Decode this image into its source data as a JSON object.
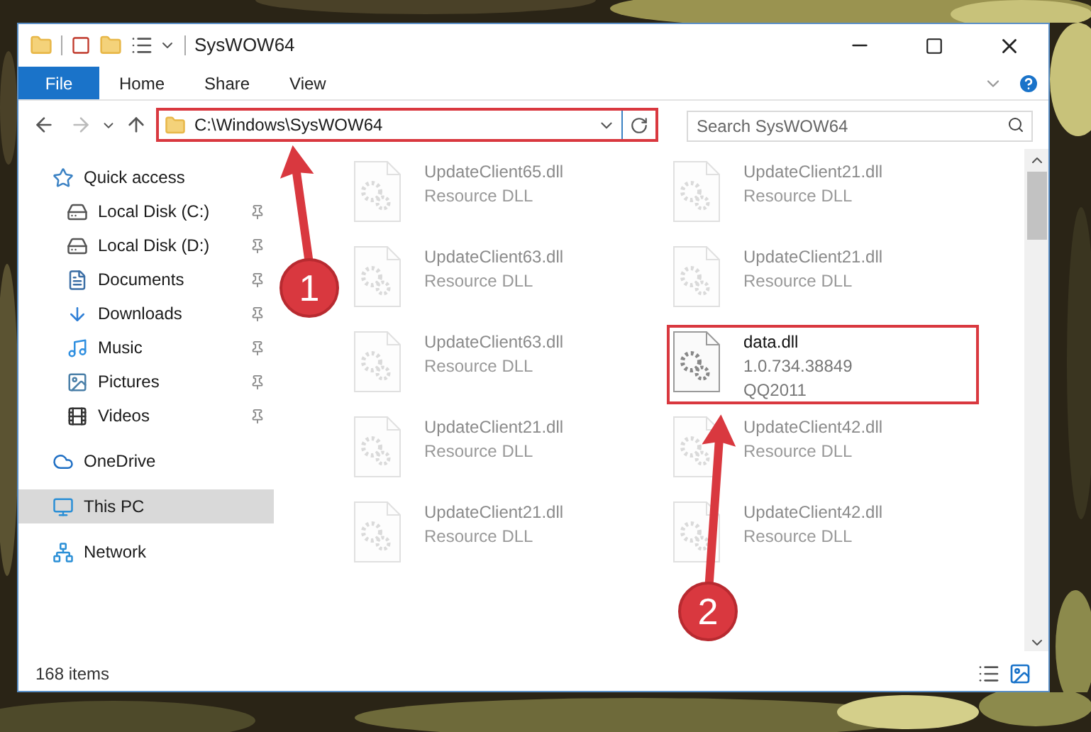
{
  "window": {
    "title": "SysWOW64"
  },
  "ribbon": {
    "file_tab": "File",
    "tabs": [
      "Home",
      "Share",
      "View"
    ]
  },
  "address": {
    "path": "C:\\Windows\\SysWOW64",
    "highlighted": true
  },
  "search": {
    "placeholder": "Search SysWOW64"
  },
  "nav": [
    {
      "label": "Quick access",
      "selected": false,
      "children": [
        {
          "label": "Local Disk (C:)",
          "pinned": true,
          "selected": false
        },
        {
          "label": "Local Disk (D:)",
          "pinned": true,
          "selected": false
        },
        {
          "label": "Documents",
          "pinned": true,
          "selected": false
        },
        {
          "label": "Downloads",
          "pinned": true,
          "selected": false
        },
        {
          "label": "Music",
          "pinned": true,
          "selected": false
        },
        {
          "label": "Pictures",
          "pinned": true,
          "selected": false
        },
        {
          "label": "Videos",
          "pinned": true,
          "selected": false
        }
      ]
    },
    {
      "label": "OneDrive",
      "selected": false
    },
    {
      "label": "This PC",
      "selected": true
    },
    {
      "label": "Network",
      "selected": false
    }
  ],
  "files": [
    {
      "name": "UpdateClient65.dll",
      "details": [
        "Resource DLL"
      ],
      "faded": true,
      "highlighted": false
    },
    {
      "name": "UpdateClient21.dll",
      "details": [
        "Resource DLL"
      ],
      "faded": true,
      "highlighted": false
    },
    {
      "name": "UpdateClient63.dll",
      "details": [
        "Resource DLL"
      ],
      "faded": true,
      "highlighted": false
    },
    {
      "name": "UpdateClient21.dll",
      "details": [
        "Resource DLL"
      ],
      "faded": true,
      "highlighted": false
    },
    {
      "name": "UpdateClient63.dll",
      "details": [
        "Resource DLL"
      ],
      "faded": true,
      "highlighted": false
    },
    {
      "name": "data.dll",
      "details": [
        "1.0.734.38849",
        "QQ2011"
      ],
      "faded": false,
      "highlighted": true
    },
    {
      "name": "UpdateClient21.dll",
      "details": [
        "Resource DLL"
      ],
      "faded": true,
      "highlighted": false
    },
    {
      "name": "UpdateClient42.dll",
      "details": [
        "Resource DLL"
      ],
      "faded": true,
      "highlighted": false
    },
    {
      "name": "UpdateClient21.dll",
      "details": [
        "Resource DLL"
      ],
      "faded": true,
      "highlighted": false
    },
    {
      "name": "UpdateClient42.dll",
      "details": [
        "Resource DLL"
      ],
      "faded": true,
      "highlighted": false
    }
  ],
  "callouts": [
    {
      "label": "1"
    },
    {
      "label": "2"
    }
  ],
  "status_bar": {
    "count": "168 items"
  }
}
